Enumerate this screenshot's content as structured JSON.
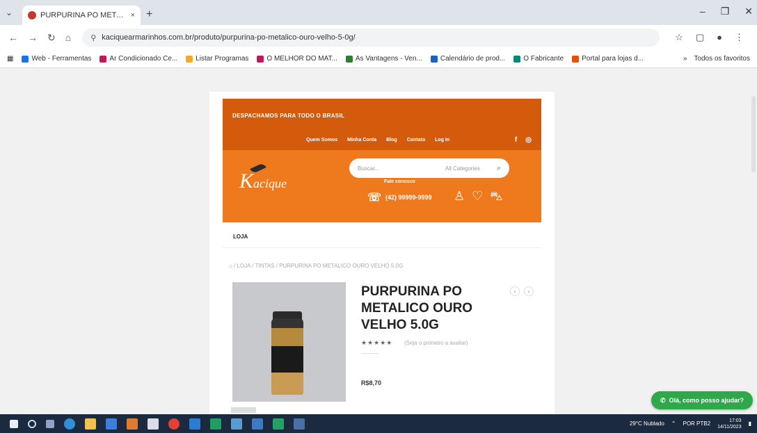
{
  "browser": {
    "tab_title": "PURPURINA PO METALICO O...",
    "tab_close": "×",
    "new_tab": "+",
    "url": "kaciquearmarinhos.com.br/produto/purpurina-po-metalico-ouro-velho-5-0g/",
    "window_controls": [
      "–",
      "❐",
      "✕"
    ],
    "bookmarks": [
      {
        "label": "Web - Ferramentas",
        "color": "#1a73e8"
      },
      {
        "label": "Ar Condicionado Ce...",
        "color": "#c2185b"
      },
      {
        "label": "Listar Programas",
        "color": "#f9a825"
      },
      {
        "label": "O MELHOR DO MAT...",
        "color": "#c2185b"
      },
      {
        "label": "As Vantagens - Ven...",
        "color": "#2e7d32"
      },
      {
        "label": "Calendário de prod...",
        "color": "#1565c0"
      },
      {
        "label": "O Fabricante",
        "color": "#00897b"
      },
      {
        "label": "Portal para lojas d...",
        "color": "#e65100"
      }
    ],
    "bookmarks_more": "»",
    "all_bookmarks": "Todos os favoritos"
  },
  "site": {
    "shipping_banner": "DESPACHAMOS PARA TODO O BRASIL",
    "menu": [
      "Quem Somos",
      "Minha Conta",
      "Blog",
      "Contato",
      "Log In"
    ],
    "social": [
      "f",
      "◎"
    ],
    "logo_k": "K",
    "logo_rest": "acique",
    "search_placeholder": "Buscar...",
    "search_category": "All Categories",
    "sub_label": "Fale conosco",
    "phone": "(42) 99999-9999",
    "section_title": "LOJA",
    "breadcrumb": "⌂  /  LOJA  /  TINTAS  /  PURPURINA PO METALICO OURO VELHO 5.0G",
    "product": {
      "title": "PURPURINA PO METALICO OURO VELHO 5.0G",
      "stars": "★★★★★",
      "reviews": "(Seja o primeiro a avaliar)",
      "price": "R$8,70"
    },
    "whatsapp_label": "Olá, como posso ajudar?"
  },
  "taskbar": {
    "weather": "29°C Nublado",
    "lang": "POR PTB2",
    "time": "17:03",
    "date": "14/11/2023"
  },
  "colors": {
    "header_dark": "#d45a0c",
    "header_light": "#ef7a1e",
    "whatsapp": "#2ea84a",
    "taskbar": "#1c2a3f"
  }
}
